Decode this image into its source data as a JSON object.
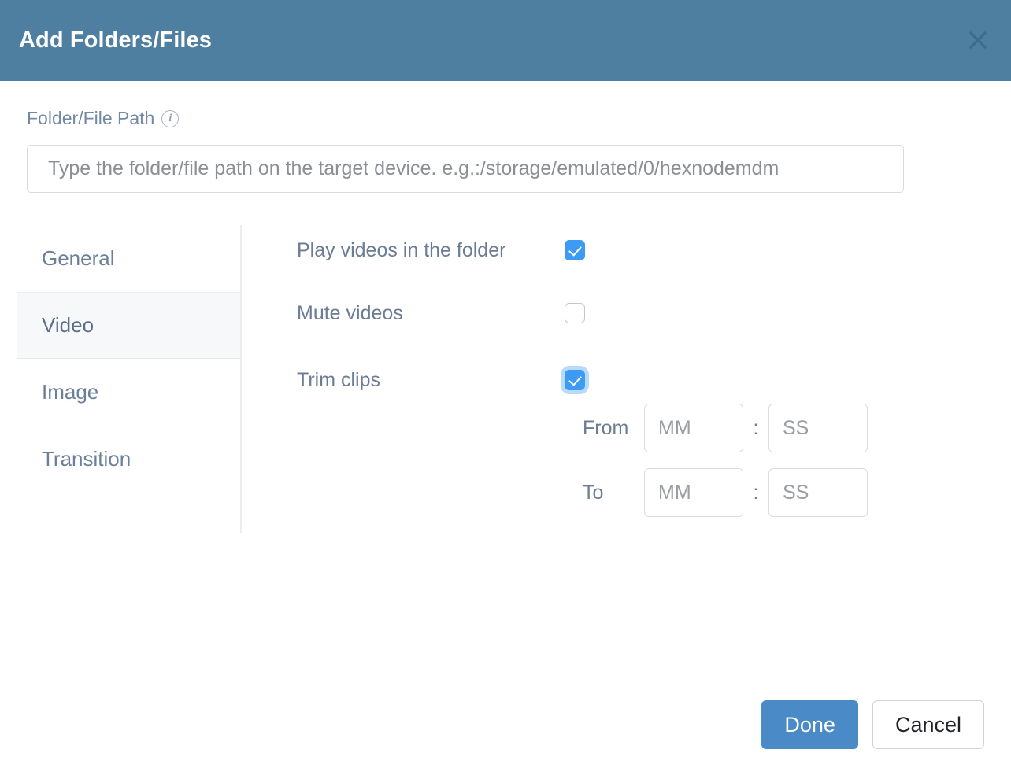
{
  "header": {
    "title": "Add Folders/Files",
    "close_icon": "close-icon"
  },
  "form": {
    "path_field": {
      "label": "Folder/File Path",
      "info_icon": "info-icon",
      "info_glyph": "i",
      "value": "",
      "placeholder": "Type the folder/file path on the target device. e.g.:/storage/emulated/0/hexnodemdm"
    }
  },
  "tabs": [
    {
      "label": "General",
      "active": false
    },
    {
      "label": "Video",
      "active": true
    },
    {
      "label": "Image",
      "active": false
    },
    {
      "label": "Transition",
      "active": false
    }
  ],
  "settings": {
    "play_videos": {
      "label": "Play videos in the folder",
      "checked": true
    },
    "mute_videos": {
      "label": "Mute videos",
      "checked": false
    },
    "trim_clips": {
      "label": "Trim clips",
      "checked": true,
      "focused": true
    },
    "trim": {
      "from": {
        "label": "From",
        "minutes_value": "",
        "minutes_placeholder": "MM",
        "separator": ":",
        "seconds_value": "",
        "seconds_placeholder": "SS"
      },
      "to": {
        "label": "To",
        "minutes_value": "",
        "minutes_placeholder": "MM",
        "separator": ":",
        "seconds_value": "",
        "seconds_placeholder": "SS"
      }
    }
  },
  "footer": {
    "done_label": "Done",
    "cancel_label": "Cancel"
  },
  "colors": {
    "header_bg": "#4f7fa0",
    "primary_button": "#4a8bc7",
    "checkbox_checked": "#3d9bf5",
    "label_text": "#6b7c93",
    "tab_active_bg": "#f7f8f9"
  }
}
